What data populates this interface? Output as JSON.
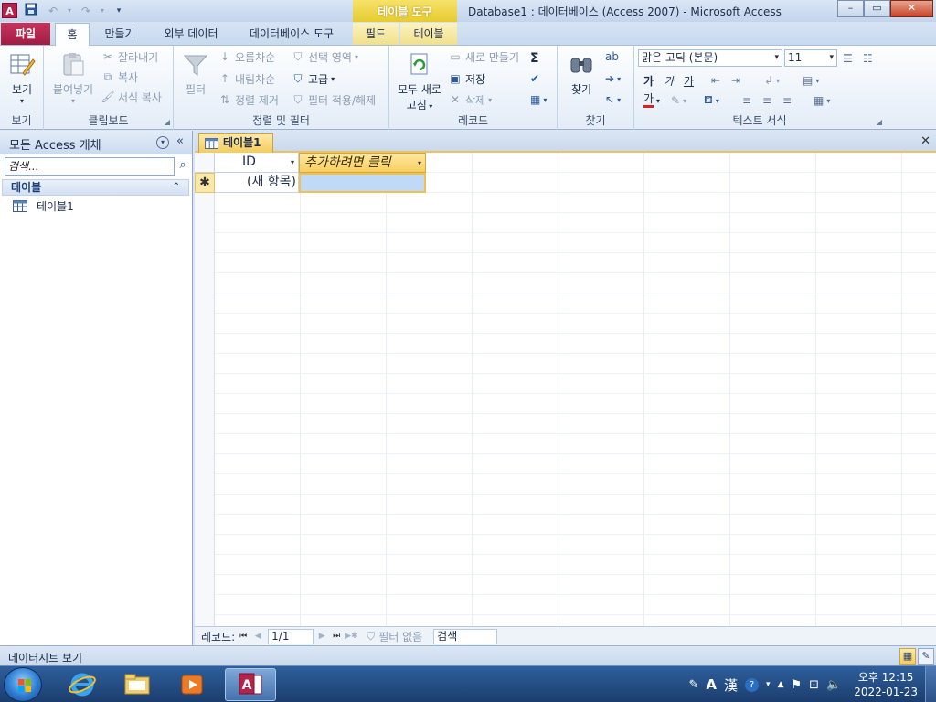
{
  "titlebar": {
    "app_icon": "A",
    "context_tab_header": "테이블 도구",
    "window_title": "Database1 : 데이터베이스 (Access 2007)  -  Microsoft Access",
    "minimize": "–",
    "maximize": "▭",
    "close": "✕"
  },
  "ribbon_tabs": {
    "file": "파일",
    "home": "홈",
    "create": "만들기",
    "external_data": "외부 데이터",
    "database_tools": "데이터베이스 도구",
    "fields": "필드",
    "table": "테이블"
  },
  "ribbon": {
    "view": {
      "label": "보기",
      "group": "보기"
    },
    "clipboard": {
      "paste": "붙여넣기",
      "cut": "잘라내기",
      "copy": "복사",
      "format_painter": "서식 복사",
      "group": "클립보드"
    },
    "sort_filter": {
      "filter": "필터",
      "ascending": "오름차순",
      "descending": "내림차순",
      "remove_sort": "정렬 제거",
      "selection": "선택 영역",
      "advanced": "고급",
      "toggle_filter": "필터 적용/해제",
      "group": "정렬 및 필터"
    },
    "records": {
      "refresh_all_line1": "모두 새로",
      "refresh_all_line2": "고침",
      "new": "새로 만들기",
      "save": "저장",
      "delete": "삭제",
      "group": "레코드"
    },
    "find": {
      "find": "찾기",
      "group": "찾기"
    },
    "text_format": {
      "font": "맑은 고딕 (본문)",
      "size": "11",
      "bold": "가",
      "italic": "가",
      "underline": "가",
      "font_color": "가",
      "group": "텍스트 서식"
    }
  },
  "navpane": {
    "title": "모든 Access 개체",
    "search_placeholder": "검색...",
    "group_label": "테이블",
    "items": [
      {
        "label": "테이블1"
      }
    ]
  },
  "document": {
    "tab_label": "테이블1",
    "columns": [
      {
        "label": "ID"
      },
      {
        "label": "추가하려면 클릭"
      }
    ],
    "new_row_marker": "✱",
    "new_row_id": "(새 항목)"
  },
  "record_nav": {
    "label": "레코드:",
    "position": "1/1",
    "filter_status": "필터 없음",
    "search": "검색"
  },
  "statusbar": {
    "text": "데이터시트 보기"
  },
  "taskbar": {
    "ime_mode": "A",
    "ime_hanja": "漢",
    "time": "오후 12:15",
    "date": "2022-01-23"
  },
  "colors": {
    "file_tab": "#b4234b",
    "context_tab": "#e5c92a",
    "accent_blue": "#2d6ec5",
    "taskbar": "#1b3d6e"
  }
}
